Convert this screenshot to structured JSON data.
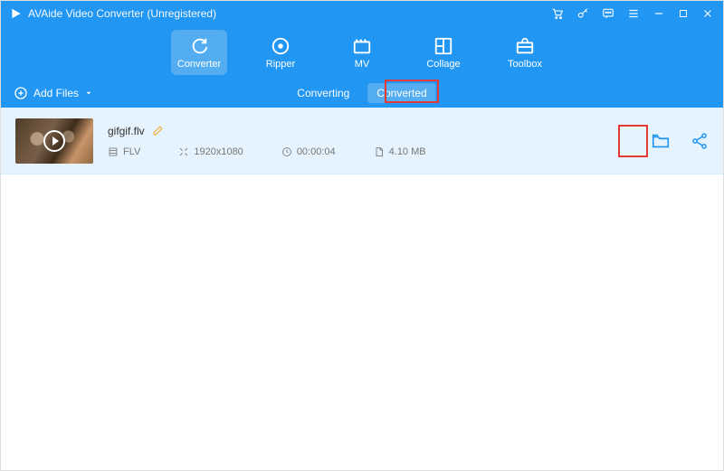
{
  "title": "AVAide Video Converter (Unregistered)",
  "nav": {
    "items": [
      {
        "label": "Converter"
      },
      {
        "label": "Ripper"
      },
      {
        "label": "MV"
      },
      {
        "label": "Collage"
      },
      {
        "label": "Toolbox"
      }
    ]
  },
  "subbar": {
    "add_files": "Add Files",
    "tabs": [
      {
        "label": "Converting"
      },
      {
        "label": "Converted"
      }
    ]
  },
  "file": {
    "name": "gifgif.flv",
    "format": "FLV",
    "resolution": "1920x1080",
    "duration": "00:00:04",
    "size": "4.10 MB"
  }
}
